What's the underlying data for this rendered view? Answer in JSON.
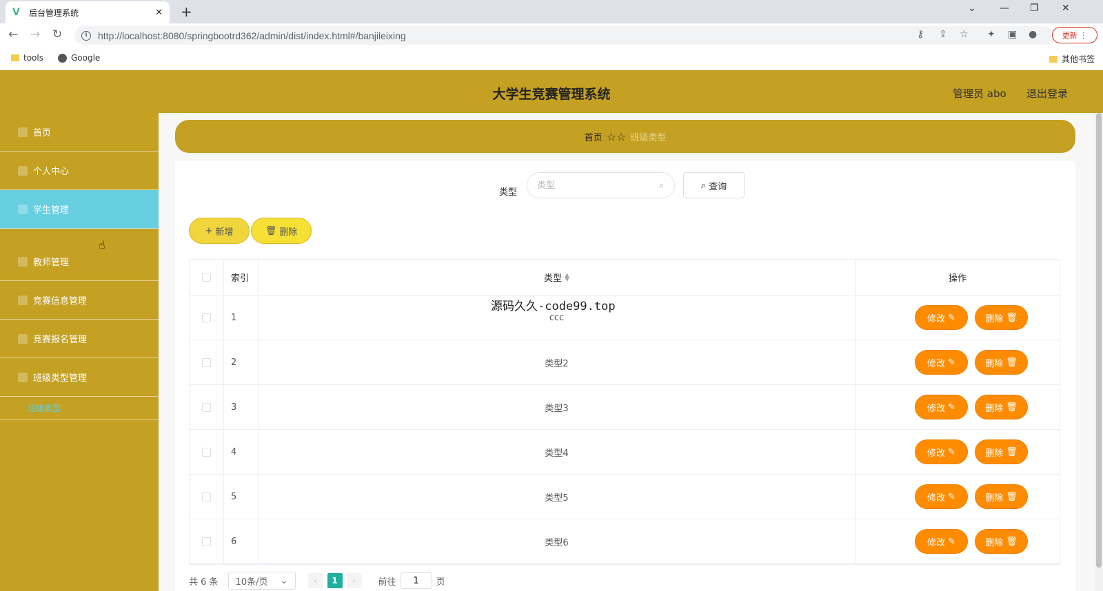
{
  "browser": {
    "tab_title": "后台管理系统",
    "url": "http://localhost:8080/springbootrd362/admin/dist/index.html#/banjileixing",
    "update_label": "更新",
    "bookmarks": [
      "tools",
      "Google"
    ],
    "other_bookmarks": "其他书签"
  },
  "header": {
    "title": "大学生竞赛管理系统",
    "admin": "管理员 abo",
    "logout": "退出登录"
  },
  "sidebar": {
    "items": [
      {
        "label": "首页"
      },
      {
        "label": "个人中心"
      },
      {
        "label": "学生管理"
      },
      {
        "label": "教师管理"
      },
      {
        "label": "竞赛信息管理"
      },
      {
        "label": "竞赛报名管理"
      },
      {
        "label": "班级类型管理"
      }
    ],
    "sub_item": "班级类型"
  },
  "breadcrumb": {
    "home": "首页",
    "current": "班级类型"
  },
  "search": {
    "label": "类型",
    "placeholder": "类型",
    "query_label": "查询"
  },
  "toolbar": {
    "add_label": "新增",
    "delete_label": "删除"
  },
  "table": {
    "headers": {
      "index": "索引",
      "type": "类型",
      "ops": "操作"
    },
    "edit_label": "修改",
    "delete_label": "删除",
    "rows": [
      {
        "index": "1",
        "type": "ccc"
      },
      {
        "index": "2",
        "type": "类型2"
      },
      {
        "index": "3",
        "type": "类型3"
      },
      {
        "index": "4",
        "type": "类型4"
      },
      {
        "index": "5",
        "type": "类型5"
      },
      {
        "index": "6",
        "type": "类型6"
      }
    ]
  },
  "overlay_text": "源码久久-code99.top",
  "pager": {
    "total": "共 6 条",
    "page_size": "10条/页",
    "current_page": "1",
    "goto_prefix": "前往",
    "goto_value": "1",
    "goto_suffix": "页"
  },
  "colors": {
    "gold": "#c4a023",
    "active_menu": "#67cfe0",
    "action_orange": "#ff8c00",
    "pager_active": "#1fb19e"
  }
}
